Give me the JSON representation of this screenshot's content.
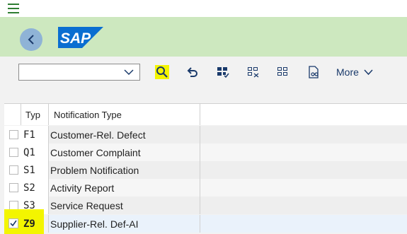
{
  "brand": {
    "logo_text": "SAP",
    "logo_color": "#0a6ed1"
  },
  "icons": {
    "menu": "hamburger-icon",
    "back": "chevron-left-icon",
    "dropdown": "chevron-down-icon",
    "search": "magnifier-icon",
    "undo": "undo-arrow-icon",
    "grid_select": "grid-select-icon",
    "grid_deselect": "grid-deselect-icon",
    "grid_detail": "grid-detail-icon",
    "document": "document-glasses-icon"
  },
  "toolbar": {
    "variant_value": "",
    "more_label": "More"
  },
  "table": {
    "columns": [
      "Typ",
      "Notification Type"
    ],
    "rows": [
      {
        "typ": "F1",
        "notification_type": "Customer-Rel. Defect",
        "checked": false
      },
      {
        "typ": "Q1",
        "notification_type": "Customer Complaint",
        "checked": false
      },
      {
        "typ": "S1",
        "notification_type": "Problem Notification",
        "checked": false
      },
      {
        "typ": "S2",
        "notification_type": "Activity Report",
        "checked": false
      },
      {
        "typ": "S3",
        "notification_type": "Service Request",
        "checked": false
      },
      {
        "typ": "Z9",
        "notification_type": "Supplier-Rel. Def-AI",
        "checked": true
      }
    ]
  },
  "colors": {
    "header_green": "#cde8bf",
    "highlight_yellow": "#f3f500",
    "accent_blue": "#1a3a6b"
  }
}
